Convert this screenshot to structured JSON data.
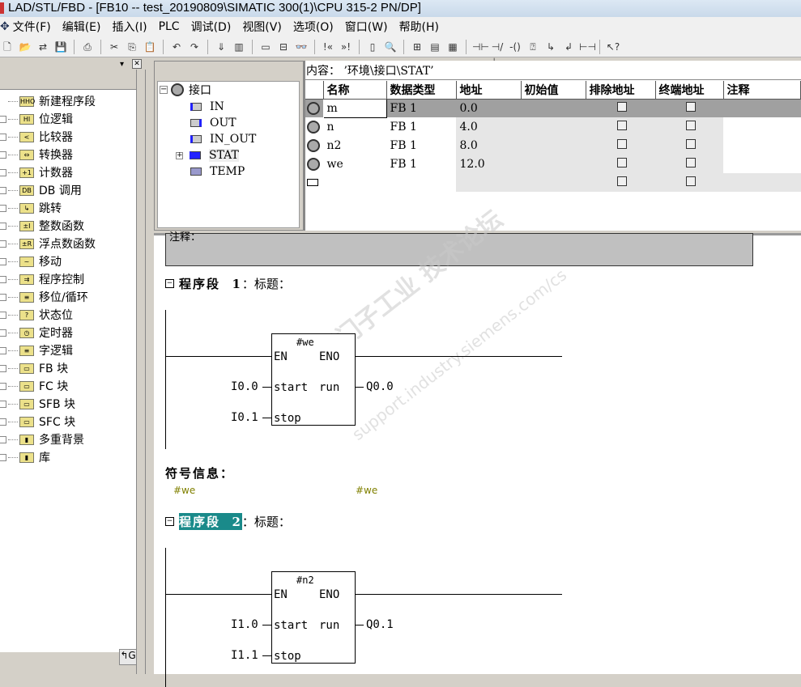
{
  "title": "LAD/STL/FBD  - [FB10 -- test_20190809\\SIMATIC 300(1)\\CPU 315-2 PN/DP]",
  "menu": [
    "文件(F)",
    "编辑(E)",
    "插入(I)",
    "PLC",
    "调试(D)",
    "视图(V)",
    "选项(O)",
    "窗口(W)",
    "帮助(H)"
  ],
  "toolbar": [
    "new",
    "open",
    "accessible-nodes",
    "save",
    "print",
    "cut",
    "copy",
    "paste",
    "undo",
    "redo",
    "download",
    "monitor",
    "overview",
    "network",
    "monitor-glasses",
    "prev",
    "next",
    "interface",
    "details",
    "new-network",
    "lad-boxes",
    "fbd-boxes",
    "nc-contact",
    "no-contact",
    "coil",
    "empty-box",
    "branch-open",
    "branch-close",
    "connect",
    "help"
  ],
  "catalog": {
    "items": [
      {
        "label": "新建程序段",
        "icon": "HHO"
      },
      {
        "label": "位逻辑",
        "icon": "HI"
      },
      {
        "label": "比较器",
        "icon": "<"
      },
      {
        "label": "转换器",
        "icon": "⇔"
      },
      {
        "label": "计数器",
        "icon": "+1"
      },
      {
        "label": "DB 调用",
        "icon": "DB"
      },
      {
        "label": "跳转",
        "icon": "↳"
      },
      {
        "label": "整数函数",
        "icon": "±I"
      },
      {
        "label": "浮点数函数",
        "icon": "±R"
      },
      {
        "label": "移动",
        "icon": "~"
      },
      {
        "label": "程序控制",
        "icon": "⇉"
      },
      {
        "label": "移位/循环",
        "icon": "≡"
      },
      {
        "label": "状态位",
        "icon": "?"
      },
      {
        "label": "定时器",
        "icon": "◷"
      },
      {
        "label": "字逻辑",
        "icon": "≡"
      },
      {
        "label": "FB 块",
        "icon": "▭"
      },
      {
        "label": "FC 块",
        "icon": "▭"
      },
      {
        "label": "SFB 块",
        "icon": "▭"
      },
      {
        "label": "SFC 块",
        "icon": "▭"
      },
      {
        "label": "多重背景",
        "icon": "▮"
      },
      {
        "label": "库",
        "icon": "▮"
      }
    ],
    "bottom_button": "↰G"
  },
  "interface": {
    "root": "接口",
    "children": [
      "IN",
      "OUT",
      "IN_OUT",
      "STAT",
      "TEMP"
    ]
  },
  "vartable": {
    "content": "内容：  ’环境\\接口\\STAT’",
    "headers": [
      "名称",
      "数据类型",
      "地址",
      "初始值",
      "排除地址",
      "终端地址",
      "注释"
    ],
    "rows": [
      {
        "name": "m",
        "type": "FB 1",
        "addr": "0.0"
      },
      {
        "name": "n",
        "type": "FB 1",
        "addr": "4.0"
      },
      {
        "name": "n2",
        "type": "FB 1",
        "addr": "8.0"
      },
      {
        "name": "we",
        "type": "FB 1",
        "addr": "12.0"
      },
      {
        "name": "",
        "type": "",
        "addr": ""
      }
    ]
  },
  "code": {
    "comment": "注释：",
    "networks": [
      {
        "label": "程序段",
        "num": "1",
        "title": "：标题：",
        "block": "#we",
        "en": "EN",
        "eno": "ENO",
        "in1": "start",
        "in2": "stop",
        "out": "run",
        "in1_addr": "I0.0",
        "in2_addr": "I0.1",
        "out_addr": "Q0.0"
      },
      {
        "label": "程序段",
        "num": "2",
        "title": "：标题：",
        "block": "#n2",
        "en": "EN",
        "eno": "ENO",
        "in1": "start",
        "in2": "stop",
        "out": "run",
        "in1_addr": "I1.0",
        "in2_addr": "I1.1",
        "out_addr": "Q0.1"
      }
    ],
    "symbol_info": "符号信息：",
    "symbols": [
      "#we",
      "#we"
    ]
  },
  "watermark": [
    "西门子工业 技术论坛",
    "support.industry.siemens.com/cs"
  ]
}
